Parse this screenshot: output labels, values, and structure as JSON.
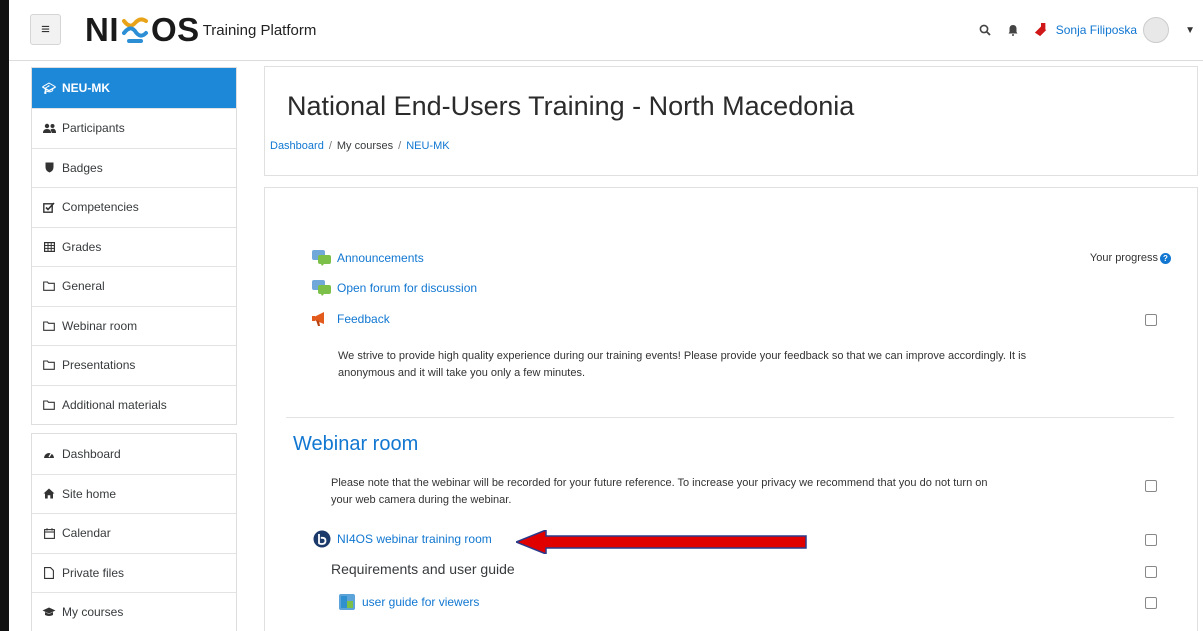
{
  "navbar": {
    "menu_label": "≡",
    "logo_left": "NI",
    "logo_right": "OS",
    "platform": "Training Platform",
    "user_name": "Sonja Filiposka"
  },
  "sidebar": {
    "course_items": [
      {
        "label": "NEU-MK",
        "icon": "graduation-cap-icon",
        "active": true
      },
      {
        "label": "Participants",
        "icon": "users-icon"
      },
      {
        "label": "Badges",
        "icon": "shield-icon"
      },
      {
        "label": "Competencies",
        "icon": "check-square-icon"
      },
      {
        "label": "Grades",
        "icon": "table-icon"
      },
      {
        "label": "General",
        "icon": "folder-icon"
      },
      {
        "label": "Webinar room",
        "icon": "folder-icon"
      },
      {
        "label": "Presentations",
        "icon": "folder-icon"
      },
      {
        "label": "Additional materials",
        "icon": "folder-icon"
      }
    ],
    "site_items": [
      {
        "label": "Dashboard",
        "icon": "tachometer-icon"
      },
      {
        "label": "Site home",
        "icon": "home-icon"
      },
      {
        "label": "Calendar",
        "icon": "calendar-icon"
      },
      {
        "label": "Private files",
        "icon": "file-icon"
      },
      {
        "label": "My courses",
        "icon": "graduation-cap-icon"
      }
    ]
  },
  "header": {
    "title": "National End-Users Training - North Macedonia",
    "breadcrumb": [
      "Dashboard",
      "My courses",
      "NEU-MK"
    ],
    "separator": "/"
  },
  "content": {
    "progress_label": "Your progress",
    "announcements": "Announcements",
    "open_forum": "Open forum for discussion",
    "feedback": "Feedback",
    "feedback_desc_1": "We strive to provide high quality experience during our training events! Please provide your feedback so that we can improve accordingly. It is",
    "feedback_desc_2": "anonymous and it will take you only a few minutes.",
    "webinar_section": "Webinar room",
    "webinar_note_1": "Please note that the webinar will be recorded for your future reference. To increase your privacy we recommend that you do not turn on",
    "webinar_note_2": "your web camera during the webinar.",
    "webinar_room_link": "NI4OS webinar training room",
    "requirements": "Requirements and user guide",
    "user_guide": "user guide for viewers"
  },
  "colors": {
    "accent": "#1177d1",
    "sidebar_active": "#1e88d8",
    "arrow": "#e00000"
  }
}
